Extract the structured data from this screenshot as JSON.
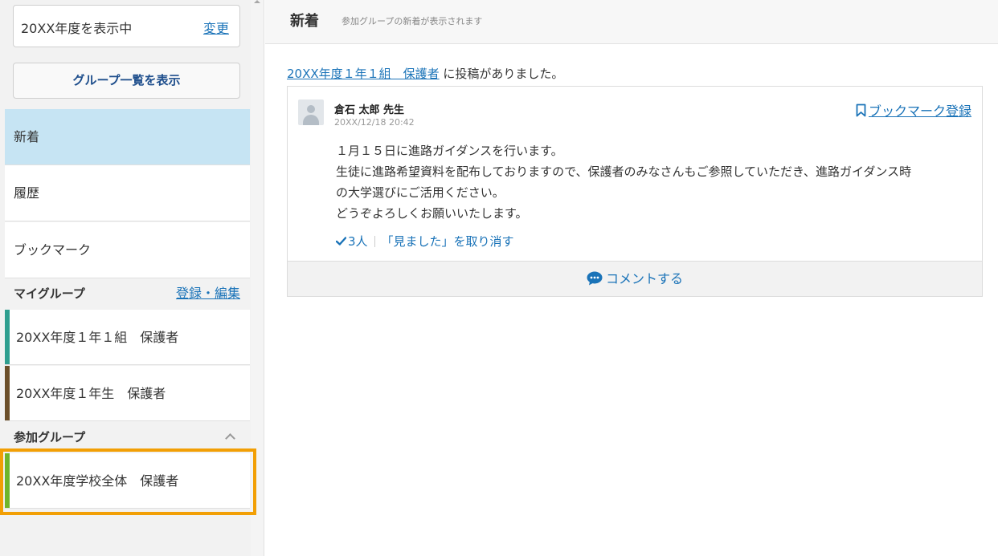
{
  "sidebar": {
    "year_display": "20XX年度を表示中",
    "year_change": "変更",
    "group_list_button": "グループ一覧を表示",
    "nav": [
      {
        "label": "新着",
        "active": true
      },
      {
        "label": "履歴",
        "active": false
      },
      {
        "label": "ブックマーク",
        "active": false
      }
    ],
    "my_groups": {
      "title": "マイグループ",
      "edit_link": "登録・編集",
      "items": [
        {
          "label": "20XX年度１年１組　保護者",
          "color": "#2e9e8f"
        },
        {
          "label": "20XX年度１年生　保護者",
          "color": "#6b4f2a"
        }
      ]
    },
    "joined_groups": {
      "title": "参加グループ",
      "items": [
        {
          "label": "20XX年度学校全体　保護者",
          "color": "#6fb52c"
        }
      ]
    }
  },
  "main": {
    "title": "新着",
    "subtitle": "参加グループの新着が表示されます",
    "notice": {
      "group_link": "20XX年度１年１組　保護者",
      "suffix": " に投稿がありました。"
    },
    "post": {
      "author": "倉石 太郎 先生",
      "date": "20XX/12/18 20:42",
      "bookmark_label": "ブックマーク登録",
      "body_lines": [
        "１月１５日に進路ガイダンスを行います。",
        "生徒に進路希望資料を配布しておりますので、保護者のみなさんもご参照していただき、進路ガイダンス時",
        "の大学選びにご活用ください。",
        "どうぞよろしくお願いいたします。"
      ],
      "seen_count": "3人",
      "seen_cancel": "「見ました」を取り消す",
      "comment_label": "コメントする"
    }
  },
  "colors": {
    "link": "#1a73b8",
    "active_nav": "#c6e4f3",
    "highlight": "#f29f05"
  }
}
